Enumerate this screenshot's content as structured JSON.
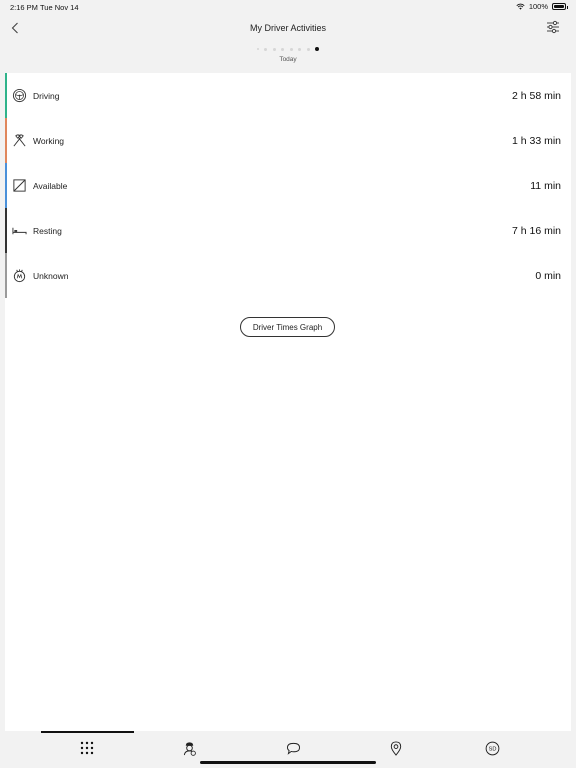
{
  "status_bar": {
    "time": "2:16 PM",
    "date": "Tue Nov 14",
    "battery": "100%"
  },
  "header": {
    "title": "My Driver Activities",
    "day_label": "Today",
    "page_dots": 8,
    "active_dot": 8
  },
  "activities": [
    {
      "label": "Driving",
      "value": "2 h 58 min",
      "color": "#2fb38a",
      "icon": "steering-wheel-icon"
    },
    {
      "label": "Working",
      "value": "1 h 33 min",
      "color": "#e0875c",
      "icon": "hammers-icon"
    },
    {
      "label": "Available",
      "value": "11 min",
      "color": "#4a90d9",
      "icon": "available-square-icon"
    },
    {
      "label": "Resting",
      "value": "7 h 16 min",
      "color": "#333333",
      "icon": "bed-icon"
    },
    {
      "label": "Unknown",
      "value": "0 min",
      "color": "#9a9a9a",
      "icon": "unknown-activity-icon"
    }
  ],
  "graph_button": {
    "label": "Driver Times Graph"
  },
  "tabbar": {
    "tabs": [
      "grid-menu-icon",
      "driver-icon",
      "message-icon",
      "location-pin-icon",
      "sd-icon"
    ],
    "active_index": 0,
    "sd_text": "SD"
  }
}
